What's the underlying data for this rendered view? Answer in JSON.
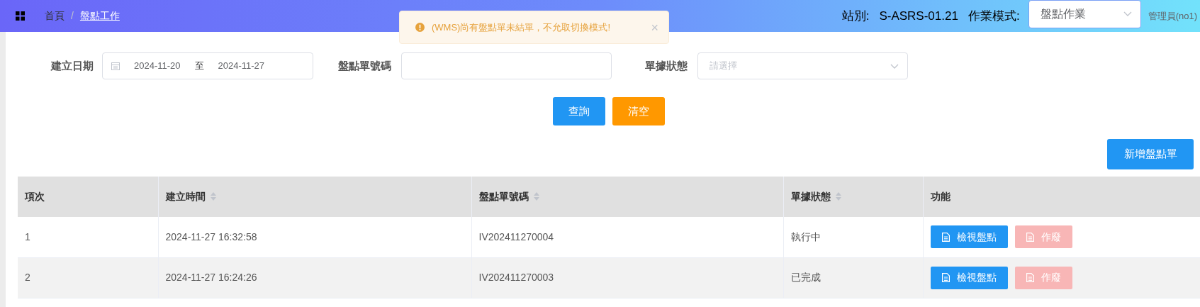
{
  "header": {
    "breadcrumb_separator": "/",
    "breadcrumb": [
      {
        "label": "首頁",
        "selected": false
      },
      {
        "label": "盤點工作",
        "selected": true
      }
    ],
    "station_label": "站別:",
    "station_value": "S-ASRS-01.21",
    "mode_label": "作業模式:",
    "mode_value": "盤點作業",
    "user": "管理員(no1)"
  },
  "toast": {
    "message": "(WMS)尚有盤點單未結單，不允取切換模式!",
    "close": "×"
  },
  "filters": {
    "date": {
      "label": "建立日期",
      "start": "2024-11-20",
      "separator": "至",
      "end": "2024-11-27"
    },
    "order_no": {
      "label": "盤點單號碼"
    },
    "status": {
      "label": "單據狀態",
      "placeholder": "請選擇"
    }
  },
  "buttons": {
    "query": "查詢",
    "clear": "清空",
    "new": "新增盤點單"
  },
  "table": {
    "columns": [
      {
        "label": "項次",
        "sortable": false
      },
      {
        "label": "建立時間",
        "sortable": true
      },
      {
        "label": "盤點單號碼",
        "sortable": true
      },
      {
        "label": "單據狀態",
        "sortable": true
      },
      {
        "label": "功能",
        "sortable": false
      }
    ],
    "rows": [
      {
        "cells": [
          "1",
          "2024-11-27 16:32:58",
          "IV202411270004",
          "執行中"
        ],
        "actions": [
          {
            "label": "檢視盤點",
            "kind": "view",
            "disabled": false
          },
          {
            "label": "作廢",
            "kind": "void",
            "disabled": true
          }
        ]
      },
      {
        "cells": [
          "2",
          "2024-11-27 16:24:26",
          "IV202411270003",
          "已完成"
        ],
        "actions": [
          {
            "label": "檢視盤點",
            "kind": "view",
            "disabled": false
          },
          {
            "label": "作廢",
            "kind": "void",
            "disabled": true
          }
        ]
      }
    ]
  }
}
